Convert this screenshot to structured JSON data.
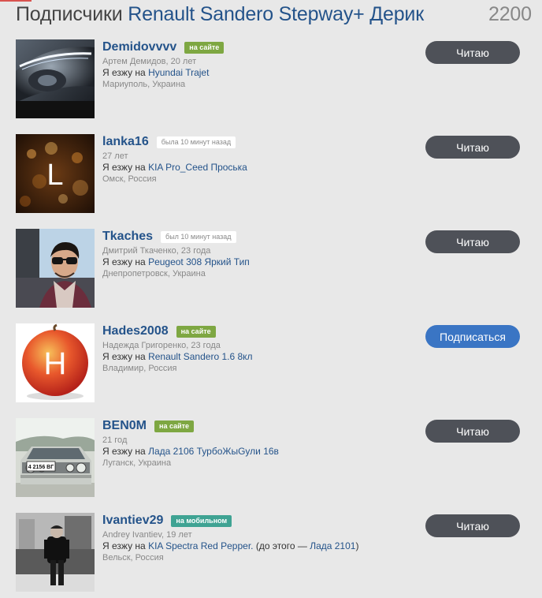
{
  "header": {
    "prefix": "Подписчики",
    "car": "Renault Sandero Stepway+ Дерик",
    "count": "2200"
  },
  "subscribers": [
    {
      "username": "Demidovvvv",
      "status": "на сайте",
      "meta": "Артем Демидов, 20 лет",
      "drives_prefix": "Я езжу на",
      "car": "Hyundai Trajet",
      "location": "Мариуполь, Украина",
      "button": "Читаю"
    },
    {
      "username": "lanka16",
      "status": "была 10 минут назад",
      "meta": "27 лет",
      "drives_prefix": "Я езжу на",
      "car": "KIA Pro_Ceed Проська",
      "location": "Омск, Россия",
      "avatar_letter": "L",
      "button": "Читаю"
    },
    {
      "username": "Tkaches",
      "status": "был 10 минут назад",
      "meta": "Дмитрий Ткаченко, 23 года",
      "drives_prefix": "Я езжу на",
      "car": "Peugeot 308 Яркий Тип",
      "location": "Днепропетровск, Украина",
      "button": "Читаю"
    },
    {
      "username": "Hades2008",
      "status": "на сайте",
      "meta": "Надежда Григоренко, 23 года",
      "drives_prefix": "Я езжу на",
      "car": "Renault Sandero 1.6 8кл",
      "location": "Владимир, Россия",
      "avatar_letter": "H",
      "button": "Подписаться"
    },
    {
      "username": "BEN0M",
      "status": "на сайте",
      "meta": "21 год",
      "drives_prefix": "Я езжу на",
      "car": "Лада 2106 ТурбоЖыGули 16в",
      "location": "Луганск, Украина",
      "plate": "4 2156 ВГ",
      "button": "Читаю"
    },
    {
      "username": "Ivantiev29",
      "status": "на мобильном",
      "meta": "Andrey Ivantiev, 19 лет",
      "drives_prefix": "Я езжу на",
      "car": "KIA Spectra Red Pepper.",
      "car_previous_prefix": "(до этого —",
      "car_previous": "Лада 2101",
      "car_previous_suffix": ")",
      "location": "Вельск, Россия",
      "button": "Читаю"
    }
  ],
  "colors": {
    "link": "#24538a",
    "online_badge": "#7ea742",
    "mobile_badge": "#3fa393",
    "read_button": "#4e5158",
    "subscribe_button": "#3a75c4"
  }
}
